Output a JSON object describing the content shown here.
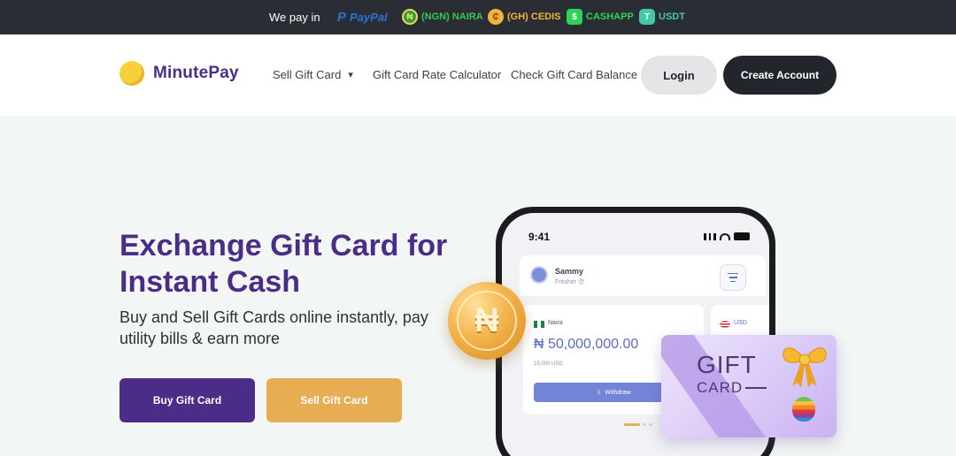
{
  "topbar": {
    "pay_label": "We pay in",
    "methods": [
      {
        "label": "PayPal",
        "icon": "paypal-icon",
        "color": "#2f6fd8"
      },
      {
        "label": "(NGN) NAIRA",
        "icon": "naira-icon",
        "color": "#34c759"
      },
      {
        "label": "(GH) CEDIS",
        "icon": "cedis-icon",
        "color": "#f2b33d"
      },
      {
        "label": "CASHAPP",
        "icon": "cashapp-icon",
        "color": "#2fd15a"
      },
      {
        "label": "USDT",
        "icon": "usdt-icon",
        "color": "#43c9a7"
      }
    ]
  },
  "header": {
    "brand": "MinutePay",
    "nav": {
      "sell": "Sell Gift Card",
      "rate": "Gift Card Rate Calculator",
      "check": "Check Gift Card Balance"
    },
    "login": "Login",
    "create": "Create Account"
  },
  "hero": {
    "title": "Exchange Gift Card for Instant Cash",
    "subtitle": "Buy and Sell Gift Cards online instantly, pay utility bills & earn more",
    "buy": "Buy Gift Card",
    "sell": "Sell Gift Card"
  },
  "phone": {
    "time": "9:41",
    "user_name": "Sammy",
    "user_level": "Fresher 😊",
    "wallet_currency": "Naira",
    "wallet_amount": "₦ 50,000,000.00",
    "wallet_usd": "15,000 USD",
    "withdraw": "Withdraw",
    "wallet2_currency": "USD"
  },
  "coin": {
    "symbol": "₦"
  },
  "giftcard": {
    "line1": "GIFT",
    "line2": "CARD"
  },
  "colors": {
    "brand_purple": "#4b2c86",
    "accent_gold": "#e6ad52",
    "dark": "#22252b",
    "hero_bg": "#f2f6f5"
  }
}
